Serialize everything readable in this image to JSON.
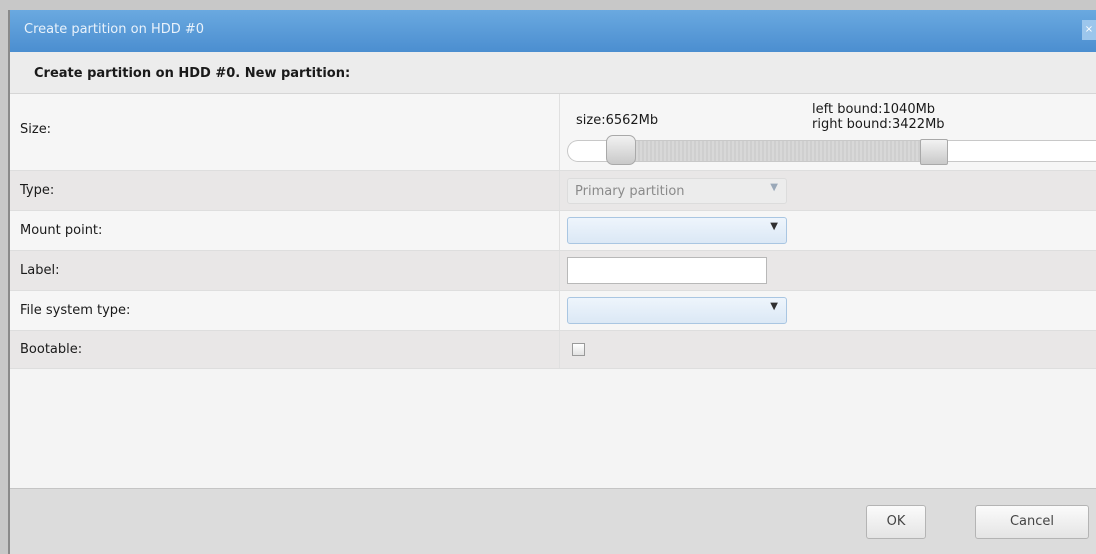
{
  "dialog": {
    "title": "Create partition on HDD #0",
    "close_glyph": "×",
    "header": "Create partition on HDD #0. New partition:"
  },
  "fields": {
    "size_label": "Size:",
    "size_value": "size:6562Mb",
    "left_bound": "left bound:1040Mb",
    "right_bound": "right bound:3422Mb",
    "type_label": "Type:",
    "type_value": "Primary partition",
    "mount_label": "Mount point:",
    "mount_value": "",
    "label_label": "Label:",
    "label_value": "",
    "fs_label": "File system type:",
    "fs_value": "",
    "bootable_label": "Bootable:",
    "bootable_checked": false
  },
  "buttons": {
    "ok": "OK",
    "cancel": "Cancel"
  },
  "icons": {
    "dropdown": "chevron-down-icon",
    "close": "close-icon"
  },
  "colors": {
    "titlebar": "#4b8ed0",
    "row_alt": "#e9e7e7"
  }
}
